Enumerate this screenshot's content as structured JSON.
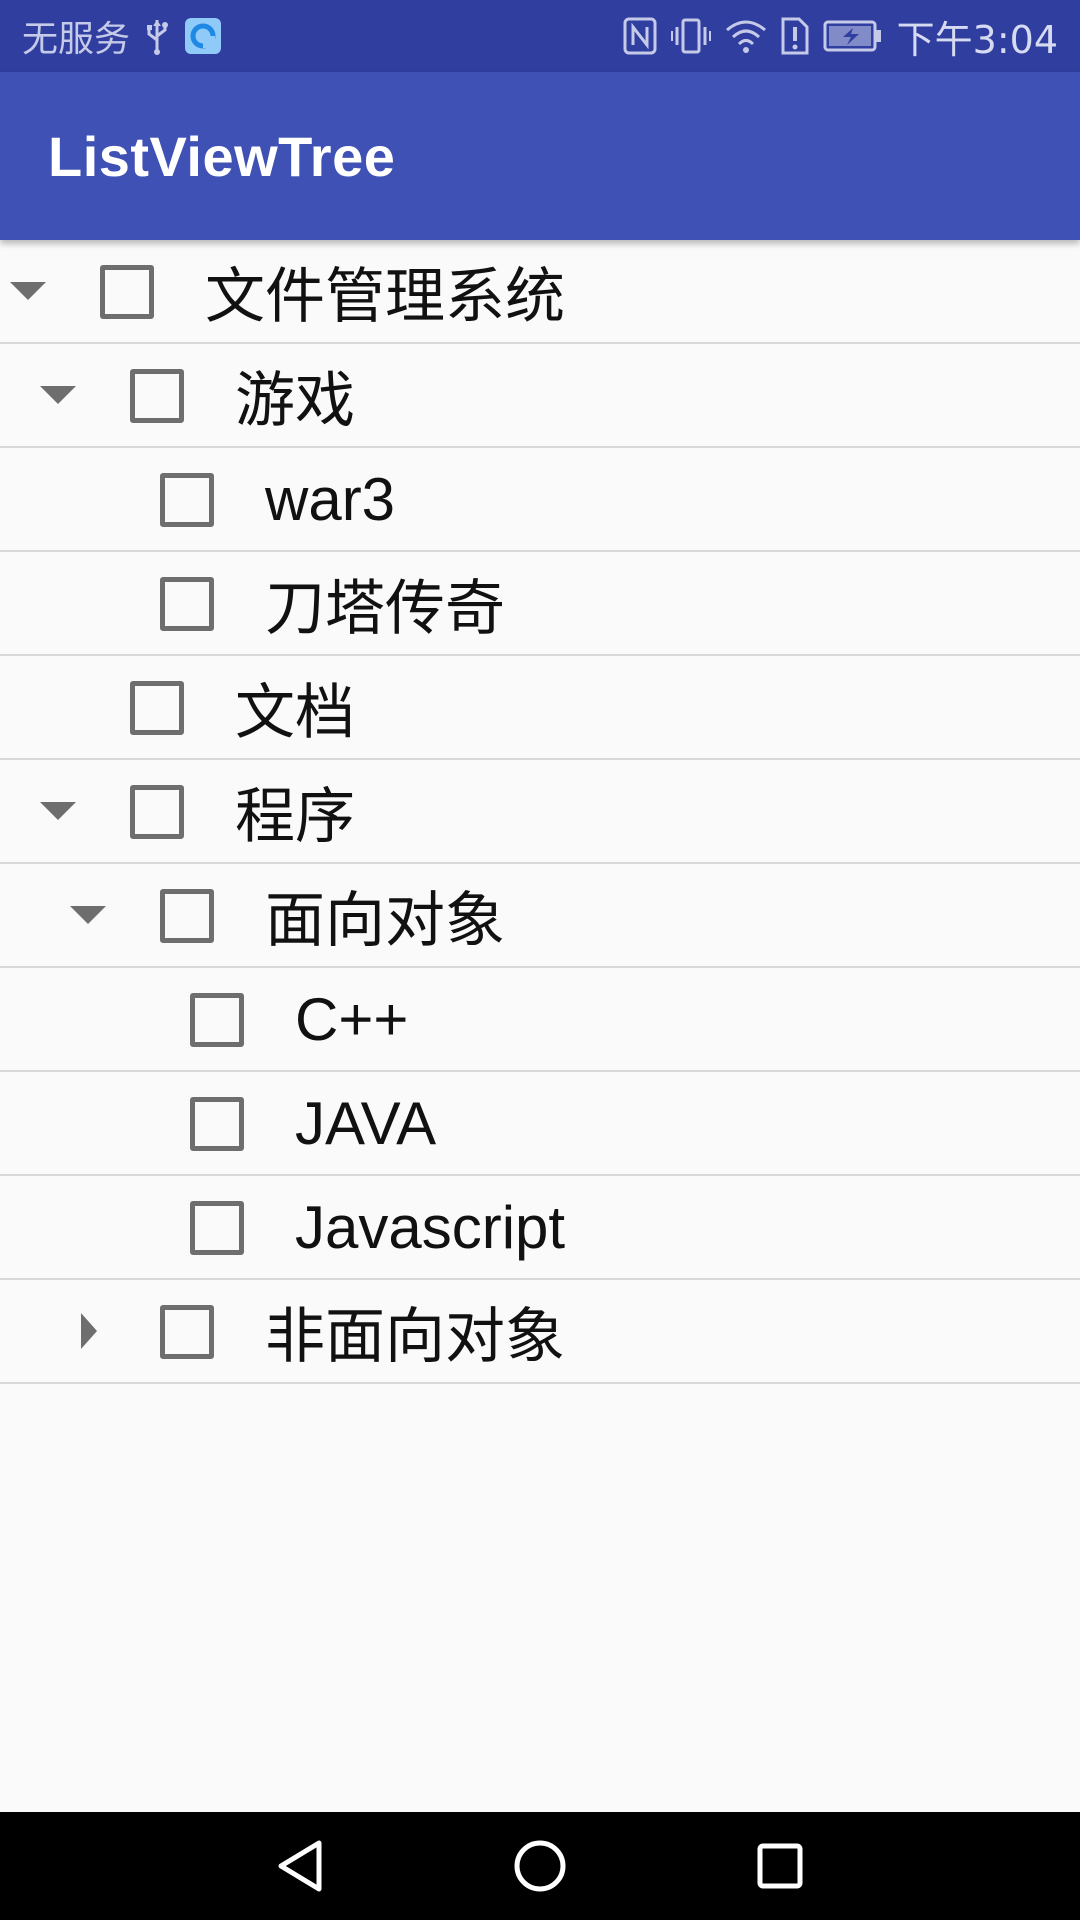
{
  "status_bar": {
    "carrier": "无服务",
    "time": "下午3:04",
    "icons": [
      "usb-icon",
      "app-notification-icon",
      "nfc-icon",
      "vibrate-icon",
      "wifi-icon",
      "sim-alert-icon",
      "battery-charging-icon"
    ]
  },
  "app_bar": {
    "title": "ListViewTree"
  },
  "tree": {
    "items": [
      {
        "label": "文件管理系统",
        "level": 0,
        "state": "expanded",
        "checked": false
      },
      {
        "label": "游戏",
        "level": 1,
        "state": "expanded",
        "checked": false
      },
      {
        "label": "war3",
        "level": 2,
        "state": "leaf",
        "checked": false
      },
      {
        "label": "刀塔传奇",
        "level": 2,
        "state": "leaf",
        "checked": false
      },
      {
        "label": "文档",
        "level": 1,
        "state": "leaf",
        "checked": false
      },
      {
        "label": "程序",
        "level": 1,
        "state": "expanded",
        "checked": false
      },
      {
        "label": "面向对象",
        "level": 2,
        "state": "expanded",
        "checked": false
      },
      {
        "label": "C++",
        "level": 3,
        "state": "leaf",
        "checked": false
      },
      {
        "label": "JAVA",
        "level": 3,
        "state": "leaf",
        "checked": false
      },
      {
        "label": "Javascript",
        "level": 3,
        "state": "leaf",
        "checked": false
      },
      {
        "label": "非面向对象",
        "level": 2,
        "state": "collapsed",
        "checked": false
      }
    ]
  },
  "nav_bar": {
    "buttons": [
      "back-icon",
      "home-icon",
      "recents-icon"
    ]
  },
  "colors": {
    "status_bar": "#303f9f",
    "app_bar": "#3f51b5",
    "background": "#fafafa",
    "divider": "#d8d8d8",
    "checkbox_border": "#6e6e6e",
    "arrow": "#6e6e6e"
  }
}
